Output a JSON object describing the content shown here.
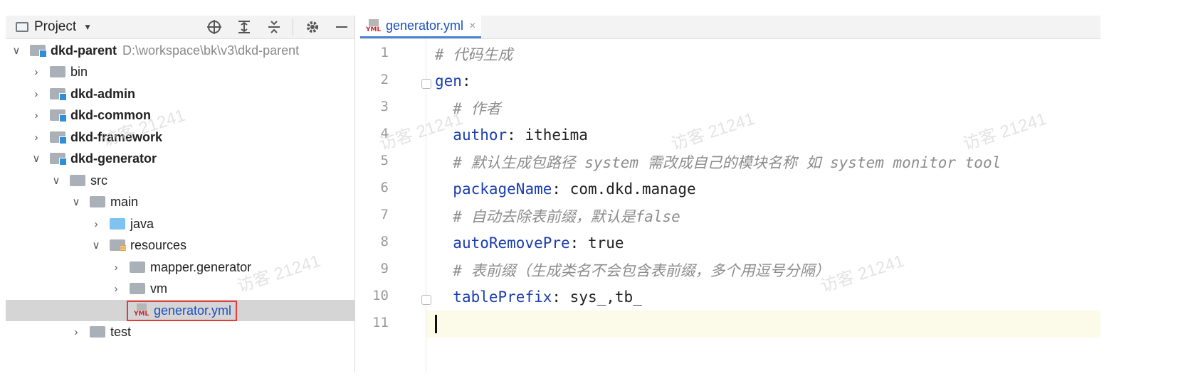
{
  "project_panel": {
    "title": "Project",
    "caret": "▼"
  },
  "tree": [
    {
      "label": "dkd-parent",
      "path": "D:\\workspace\\bk\\v3\\dkd-parent",
      "level": 0,
      "expanded": true,
      "bold": true,
      "icon": "module-folder-icon"
    },
    {
      "label": "bin",
      "level": 1,
      "expanded": false,
      "bold": false,
      "icon": "folder-icon"
    },
    {
      "label": "dkd-admin",
      "level": 1,
      "expanded": false,
      "bold": true,
      "icon": "module-folder-icon"
    },
    {
      "label": "dkd-common",
      "level": 1,
      "expanded": false,
      "bold": true,
      "icon": "module-folder-icon"
    },
    {
      "label": "dkd-framework",
      "level": 1,
      "expanded": false,
      "bold": true,
      "icon": "module-folder-icon"
    },
    {
      "label": "dkd-generator",
      "level": 1,
      "expanded": true,
      "bold": true,
      "icon": "module-folder-icon"
    },
    {
      "label": "src",
      "level": 2,
      "expanded": true,
      "bold": false,
      "icon": "folder-icon"
    },
    {
      "label": "main",
      "level": 3,
      "expanded": true,
      "bold": false,
      "icon": "folder-icon"
    },
    {
      "label": "java",
      "level": 4,
      "expanded": false,
      "bold": false,
      "icon": "source-folder-icon"
    },
    {
      "label": "resources",
      "level": 4,
      "expanded": true,
      "bold": false,
      "icon": "resources-folder-icon"
    },
    {
      "label": "mapper.generator",
      "level": 5,
      "expanded": false,
      "bold": false,
      "icon": "folder-icon"
    },
    {
      "label": "vm",
      "level": 5,
      "expanded": false,
      "bold": false,
      "icon": "folder-icon"
    },
    {
      "label": "generator.yml",
      "level": 5,
      "selected": true,
      "icon": "yml-file-icon"
    },
    {
      "label": "test",
      "level": 2,
      "expanded": false,
      "bold": false,
      "icon": "folder-icon"
    }
  ],
  "editor_tab": {
    "label": "generator.yml",
    "icon_text": "YML",
    "close": "×"
  },
  "code_lines": [
    {
      "n": "1",
      "indent": "",
      "comment": "# 代码生成"
    },
    {
      "n": "2",
      "indent": "",
      "key": "gen",
      "sep": ":",
      "value": ""
    },
    {
      "n": "3",
      "indent": "  ",
      "comment": "# 作者"
    },
    {
      "n": "4",
      "indent": "  ",
      "key": "author",
      "sep": ": ",
      "value": "itheima"
    },
    {
      "n": "5",
      "indent": "  ",
      "comment": "# 默认生成包路径 system 需改成自己的模块名称 如 system monitor tool"
    },
    {
      "n": "6",
      "indent": "  ",
      "key": "packageName",
      "sep": ": ",
      "value": "com.dkd.manage"
    },
    {
      "n": "7",
      "indent": "  ",
      "comment": "# 自动去除表前缀，默认是false"
    },
    {
      "n": "8",
      "indent": "  ",
      "key": "autoRemovePre",
      "sep": ": ",
      "value": "true"
    },
    {
      "n": "9",
      "indent": "  ",
      "comment": "# 表前缀（生成类名不会包含表前缀，多个用逗号分隔）"
    },
    {
      "n": "10",
      "indent": "  ",
      "key": "tablePrefix",
      "sep": ": ",
      "value": "sys_,tb_"
    },
    {
      "n": "11",
      "indent": "",
      "current": true
    }
  ],
  "colors": {
    "key": "#1a3eae",
    "comment": "#8c8c8c",
    "selection": "#d5d5d5",
    "highlight_box": "#e53b3b",
    "current_line": "#fcfae9",
    "tab_underline": "#4a84d4"
  },
  "watermark": "访客 21241"
}
